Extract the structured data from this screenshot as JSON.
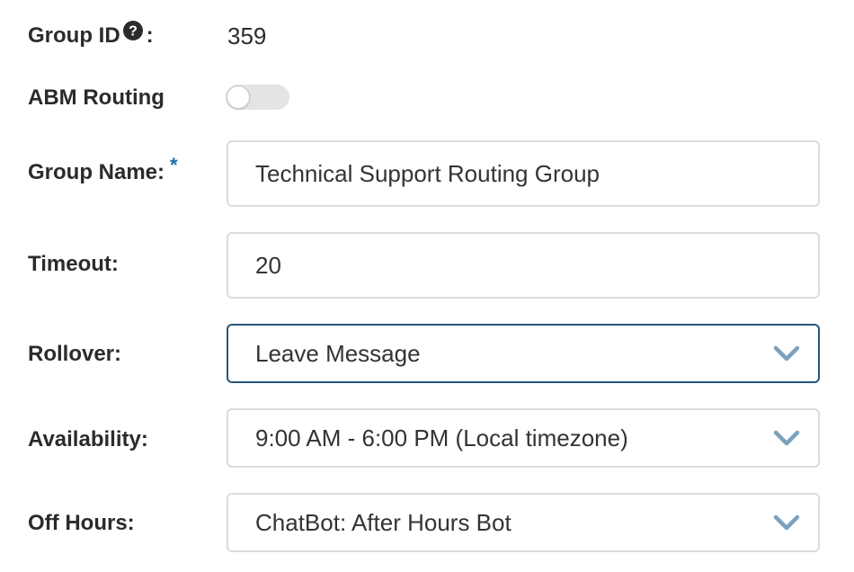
{
  "form": {
    "group_id": {
      "label": "Group ID",
      "suffix": ":",
      "value": "359",
      "help_icon": "question-circle-icon"
    },
    "abm_routing": {
      "label": "ABM Routing",
      "enabled": false
    },
    "group_name": {
      "label": "Group Name:",
      "required_marker": "*",
      "value": "Technical Support Routing Group"
    },
    "timeout": {
      "label": "Timeout:",
      "value": "20"
    },
    "rollover": {
      "label": "Rollover:",
      "selected": "Leave Message",
      "icon": "chevron-down-icon"
    },
    "availability": {
      "label": "Availability:",
      "selected": "9:00 AM - 6:00 PM (Local timezone)",
      "icon": "chevron-down-icon"
    },
    "off_hours": {
      "label": "Off Hours:",
      "selected": "ChatBot: After Hours Bot",
      "icon": "chevron-down-icon"
    }
  },
  "colors": {
    "focus_border": "#27567a",
    "required_marker": "#1a6aa8",
    "chevron": "#7aa2bf",
    "toggle_off": "#e4e4e4"
  }
}
